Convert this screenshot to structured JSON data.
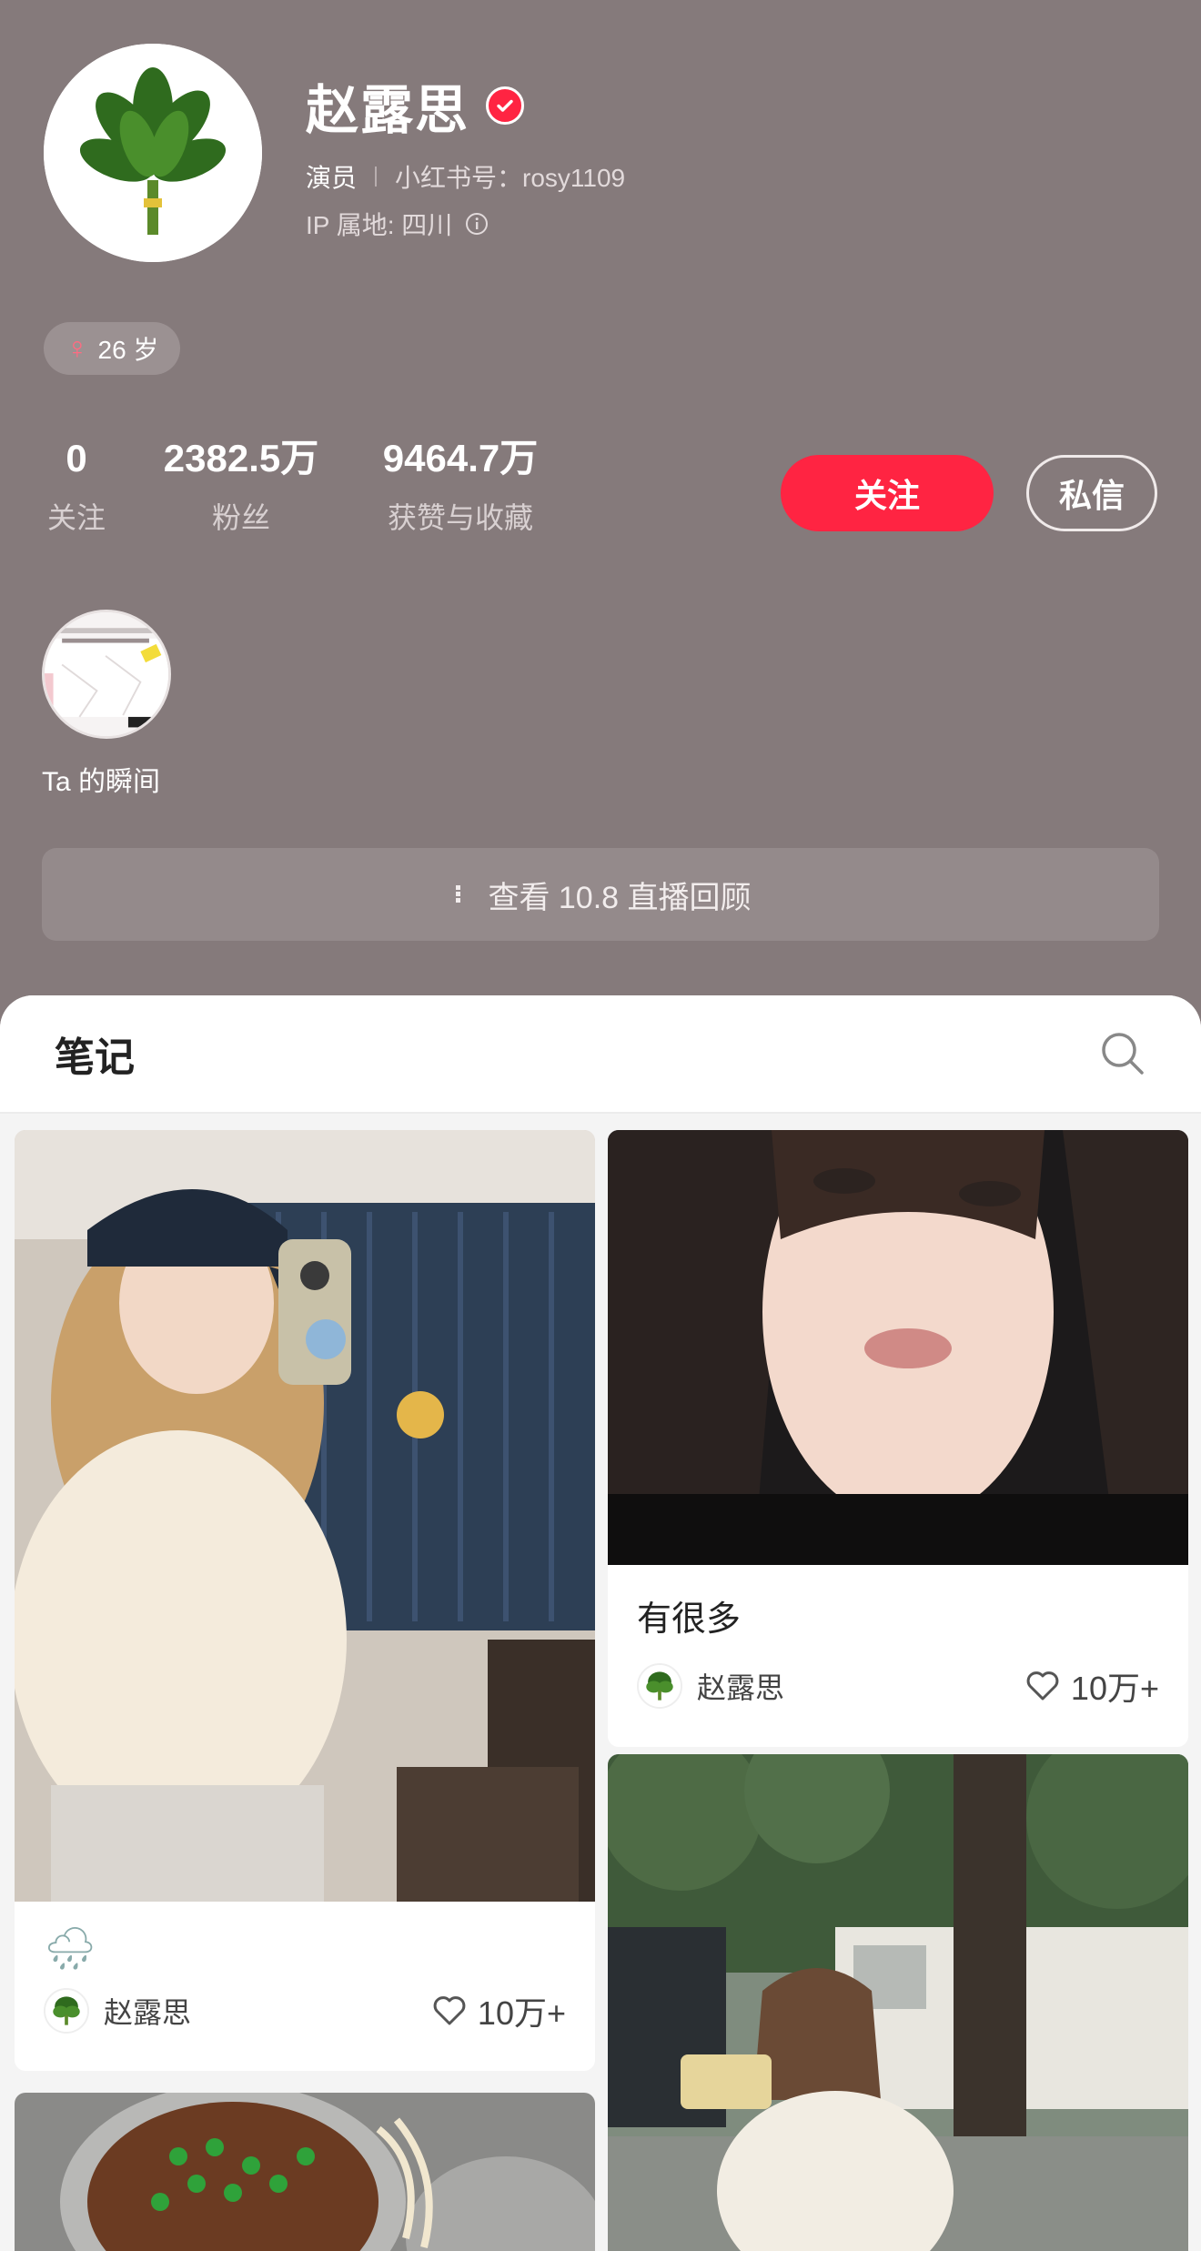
{
  "profile": {
    "name": "赵露思",
    "role": "演员",
    "xhs_id": "小红书号：rosy1109",
    "ip": "IP 属地: 四川",
    "age": "26 岁"
  },
  "stats": {
    "following_num": "0",
    "following_label": "关注",
    "fans_num": "2382.5万",
    "fans_label": "粉丝",
    "likes_num": "9464.7万",
    "likes_label": "获赞与收藏"
  },
  "actions": {
    "follow": "关注",
    "message": "私信"
  },
  "moments": {
    "label": "Ta 的瞬间"
  },
  "live": {
    "label": "查看 10.8 直播回顾"
  },
  "notes": {
    "title": "笔记",
    "cards": [
      {
        "title": "",
        "author": "赵露思",
        "likes": "10万+"
      },
      {
        "title": "有很多",
        "author": "赵露思",
        "likes": "10万+"
      }
    ]
  },
  "colors": {
    "header_bg": "#857a7b",
    "accent": "#ff2442",
    "panel_bg": "#f4f4f4"
  },
  "icons": [
    "verified-icon",
    "info-icon",
    "female-icon",
    "live-icon",
    "search-icon",
    "heart-icon",
    "rain-cloud-icon"
  ]
}
